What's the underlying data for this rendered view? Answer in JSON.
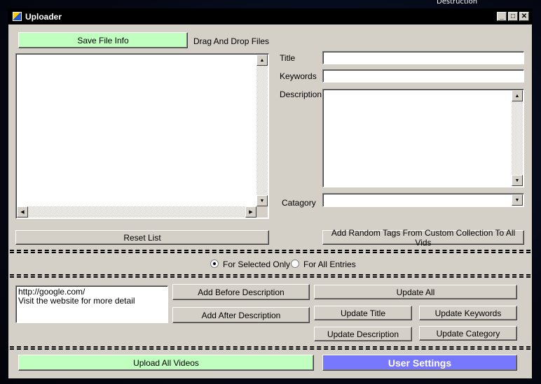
{
  "background": {
    "top_right_text": "Destruction"
  },
  "window": {
    "title": "Uploader",
    "minimize_glyph": "_",
    "maximize_glyph": "□",
    "close_glyph": "✕"
  },
  "left_panel": {
    "save_button": "Save File Info",
    "drag_drop_label": "Drag And Drop Files",
    "reset_button": "Reset List"
  },
  "form": {
    "title_label": "Title",
    "title_value": "",
    "keywords_label": "Keywords",
    "keywords_value": "",
    "description_label": "Description",
    "description_value": "",
    "category_label": "Catagory",
    "category_value": "",
    "random_tags_button": "Add Random Tags From Custom Collection To All Vids"
  },
  "scope": {
    "options": [
      {
        "label": "For Selected Only",
        "checked": true
      },
      {
        "label": "For All Entries",
        "checked": false
      }
    ]
  },
  "append": {
    "text": "http://google.com/\nVisit the website for more detail",
    "add_before_button": "Add Before Description",
    "add_after_button": "Add After Description"
  },
  "updates": {
    "update_all": "Update All",
    "update_title": "Update Title",
    "update_keywords": "Update Keywords",
    "update_description": "Update Description",
    "update_category": "Update Category"
  },
  "footer": {
    "upload_button": "Upload All Videos",
    "settings_button": "User Settings"
  },
  "colors": {
    "green_button": "#c0ffc0",
    "blue_button": "#7878ff",
    "window_face": "#d4d0c8"
  },
  "icons": {
    "scroll_up": "▲",
    "scroll_down": "▼",
    "scroll_left": "◀",
    "scroll_right": "▶",
    "dropdown": "▼"
  }
}
